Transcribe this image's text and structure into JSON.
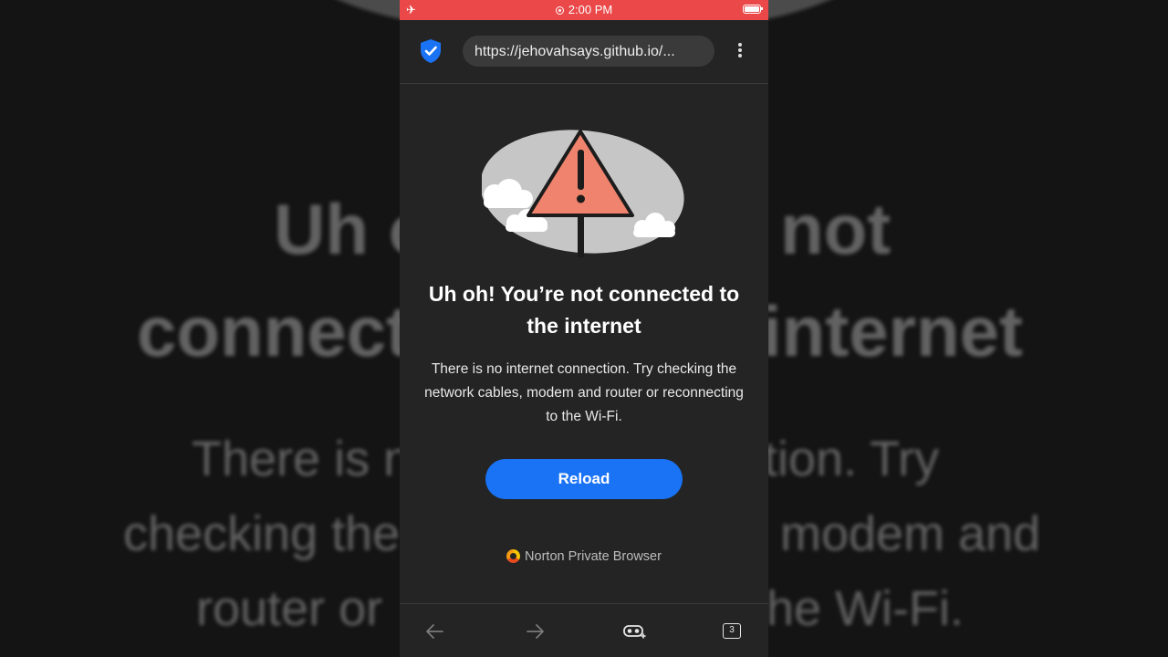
{
  "status_bar": {
    "time": "2:00 PM",
    "airplane_icon": "airplane-icon",
    "battery_icon": "battery-icon"
  },
  "toolbar": {
    "url": "https://jehovahsays.github.io/...",
    "shield_icon": "norton-shield-check-icon",
    "menu_icon": "more-vertical-icon"
  },
  "error": {
    "title": "Uh oh! You’re not connected to the internet",
    "description": "There is no internet connection. Try checking the network cables, modem and router or reconnecting to the Wi-Fi.",
    "reload_label": "Reload",
    "illustration": "warning-sign-icon"
  },
  "branding": {
    "label": "Norton Private Browser"
  },
  "bottom_bar": {
    "tab_count": "3",
    "icons": [
      "back-arrow-icon",
      "forward-arrow-icon",
      "private-mask-icon",
      "tabs-icon"
    ]
  },
  "background_copy": {
    "title_line1_left": "Uh o",
    "title_line1_right": "not",
    "title_line2_left": "connect",
    "title_line2_right": "internet",
    "body_line1_left": "There is n",
    "body_line1_right": "ection. Try",
    "body_line2_left": "checking the",
    "body_line2_right": "modem and",
    "body_line3_left": "router or",
    "body_line3_right": "he Wi-Fi."
  },
  "colors": {
    "status_bar": "#ea4849",
    "accent": "#1a73f5",
    "page_bg": "#242424",
    "warning": "#f0836d"
  }
}
